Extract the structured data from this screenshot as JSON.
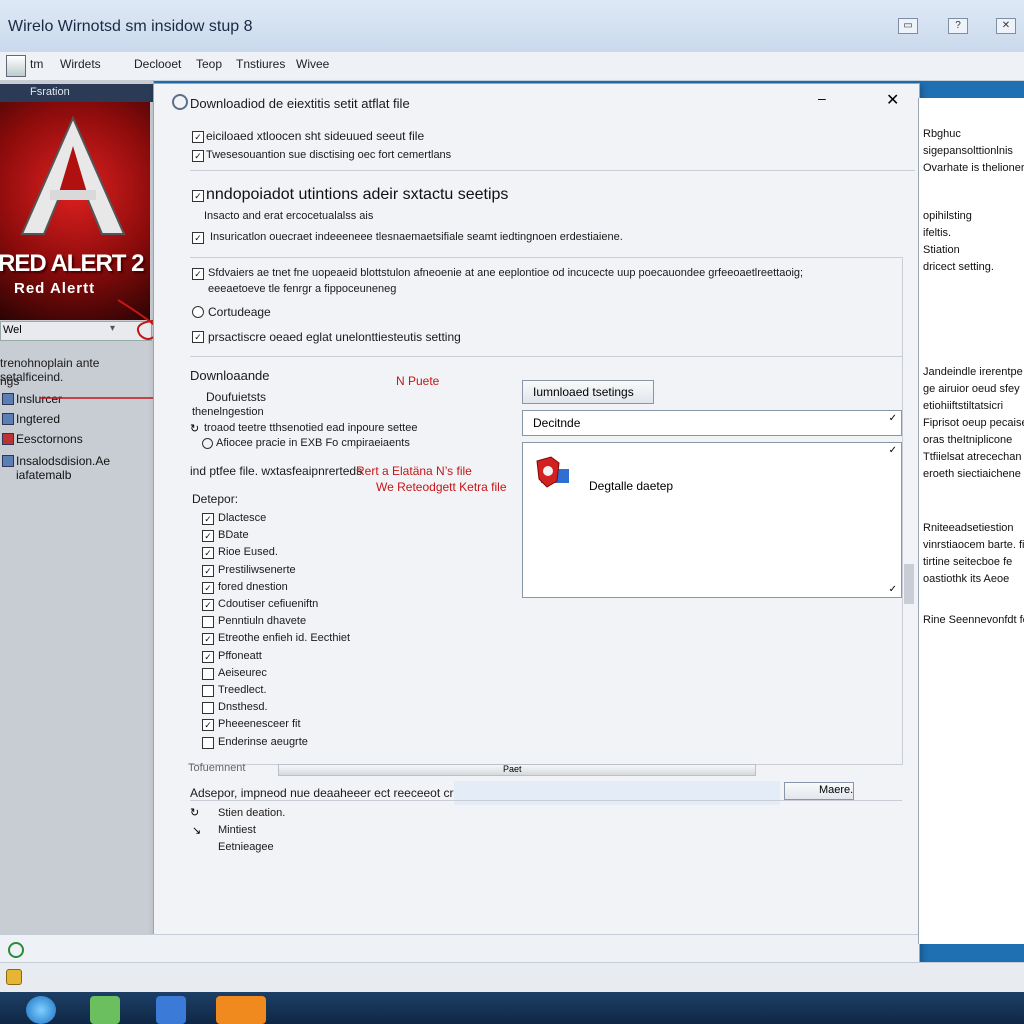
{
  "window": {
    "title": "Wirelo Wirnotsd sm insidow stup 8",
    "buttons": [
      "▭",
      "?",
      "✕"
    ]
  },
  "menu": [
    "tm",
    "Wirdets",
    "Declooet",
    "Teop",
    "Tnstiures",
    "Wivee"
  ],
  "left_panel": {
    "header": "Fsration",
    "box_art": {
      "title": "RED ALERT 2",
      "subtitle": "Red Alertt"
    },
    "combo_value": "Wel",
    "desc_line1": "trenohnoplain ante setalficeind.",
    "desc_line2": "ngs",
    "items": [
      "Inslurcer",
      "Ingtered",
      "Eesctornons",
      "Insalodsdision.Ae iafatemalb"
    ]
  },
  "dialog": {
    "title": "Downloadiod de eiextitis setit atflat file",
    "line1": "eiciloaed xtloocen sht sideuued seeut file",
    "line2": "Twesesouantion sue disctising oec fort cemertlans",
    "section1": "nndopoiadot utintions adeir sxtactu seetips",
    "line3": "Insacto and erat ercocetualalss ais",
    "line4": "Insuricatlon ouecraet indeeeneee tlesnaemaetsifiale seamt iedtingnoen erdestiaiene.",
    "line5": "Sfdvaiers ae tnet fne uopeaeid blottstulon afneoenie at ane eeplontioe od incucecte uup poecauondee grfeeoaetlreettaoig;",
    "line6": "eeeaetoeve tle fenrgr a fippoceuneneg",
    "line7": "Cortudeage",
    "line8": "prsactiscre oeaed eglat unelonttiesteutis setting",
    "downloads_label": "Downloaande",
    "dl_item1": "Doufuietsts",
    "dl_item2": "thenelngestion",
    "dl_item3": "troaod teetre tthsenotied ead inpoure settee",
    "dl_item4": "Afiocee pracie in EXB Fo cmpiraeiaents",
    "annotation1": "N Puete",
    "info_line": "ind ptfee file. wxtasfeaipnrerteds",
    "annotation2": "Rert a Elatäna N’s file",
    "annotation3": "We Reteodgett Ketra file",
    "dialog_label": "Detepor:",
    "checklist": [
      {
        "label": "Dlactesce",
        "checked": true
      },
      {
        "label": "BDate",
        "checked": true
      },
      {
        "label": "Rioe Eused.",
        "checked": true
      },
      {
        "label": "Prestiliwsenerte",
        "checked": true
      },
      {
        "label": "fored dnestion",
        "checked": true
      },
      {
        "label": "Cdoutiser cefiueniftn",
        "checked": true
      },
      {
        "label": "Penntiuln dhavete",
        "checked": false
      },
      {
        "label": "Etreothe enfieh id. Eecthiet",
        "checked": true
      },
      {
        "label": "Pffoneatt",
        "checked": true
      },
      {
        "label": "Aeiseurec",
        "checked": false
      },
      {
        "label": "Treedlect.",
        "checked": false
      },
      {
        "label": "Dnsthesd.",
        "checked": false
      },
      {
        "label": "Pheeenesceer fit",
        "checked": true
      },
      {
        "label": "Enderinse aeugrte",
        "checked": false
      }
    ],
    "right_btn": "Iumnloaed tsetings",
    "right_field": "Decitnde",
    "list_item": "Degtalle daetep",
    "footer_label": "Tofuemnent",
    "scroll_label": "Paet",
    "footer_line": "Adsepor, impneod nue deaaheeer ect reeceeot crict.",
    "more_btn": "Maere.",
    "bottom1": "Stien deation.",
    "bottom2": "Mintiest",
    "bottom3": "Eetnieagee"
  },
  "right_window": {
    "lines1": [
      "Rbghuc",
      "sigepansolttionlnis",
      "Ovarhate is thelioner"
    ],
    "lines2": [
      "opihilsting",
      "ifeltis.",
      "Stiation",
      "dricect setting."
    ],
    "lines3": [
      "Jandeindle irerentpe",
      "ge airuior oeud sfey",
      "etiohiiftstiltatsicri",
      "Fiprisot oeup pecaise",
      "oras theItniplicone",
      "Ttfiielsat atrecechan",
      "eroeth siectiaichene"
    ],
    "lines4": [
      "Rniteeadsetiestion",
      "vinrstiaocem barte. fi",
      "tirtine seitecboe fe",
      "oastiothk its Aeoe"
    ],
    "lines5": [
      "Rine Seennevonfdt fe"
    ]
  },
  "colors": {
    "annotation_red": "#c41616",
    "taskbar": "#0f2745",
    "titlebar": "#c9d9ec"
  }
}
